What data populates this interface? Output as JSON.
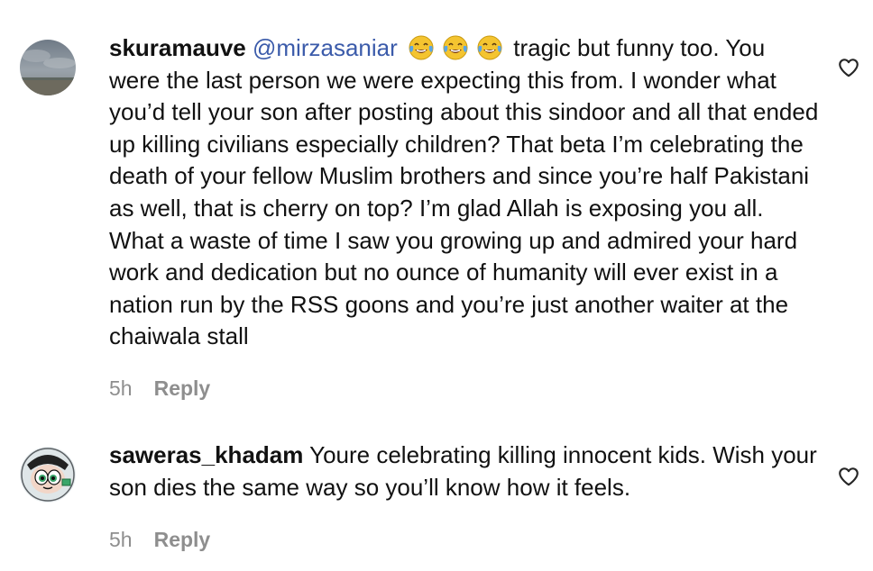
{
  "comments": [
    {
      "username": "skuramauve",
      "mention": "@mirzasaniar",
      "emojis": [
        "face-with-tears-of-joy",
        "face-with-tears-of-joy",
        "face-with-tears-of-joy"
      ],
      "text": " tragic but funny too. You were the last person we were expecting this from. I wonder what you’d tell your son after posting about this sindoor and all that ended up killing civilians especially children? That beta I’m celebrating the death of your fellow Muslim brothers and since you’re half Pakistani as well, that is cherry on top? I’m glad Allah is exposing you all. What a waste of time I saw you growing up and admired your hard work and dedication but no ounce of humanity will ever exist in a nation run by the RSS goons and you’re just another waiter at the chaiwala stall",
      "time": "5h",
      "reply_label": "Reply"
    },
    {
      "username": "saweras_khadam",
      "text": " Youre celebrating killing innocent kids. Wish your son dies the same way so you’ll know how it feels.",
      "time": "5h",
      "reply_label": "Reply"
    }
  ],
  "colors": {
    "mention": "#3b5baa",
    "meta": "#8e8e8e",
    "text": "#111111"
  }
}
